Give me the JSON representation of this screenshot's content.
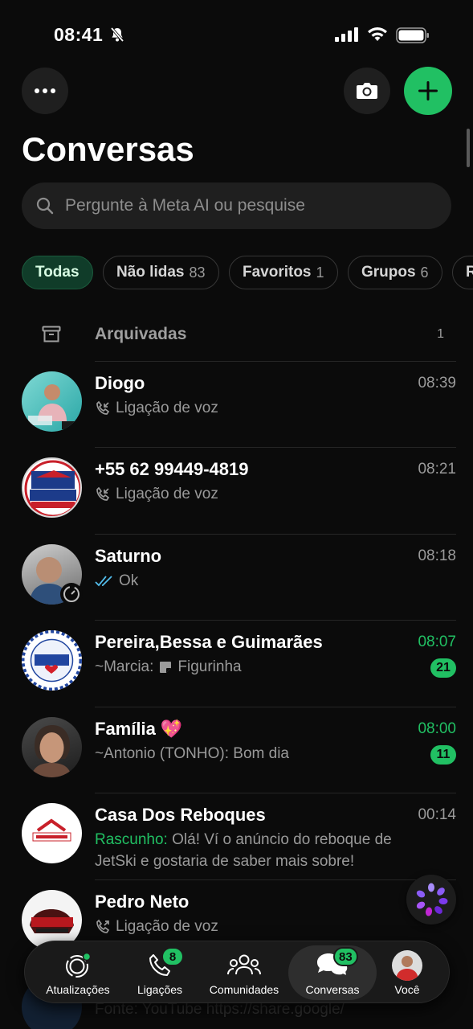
{
  "status_bar": {
    "time": "08:41"
  },
  "header": {
    "title": "Conversas"
  },
  "search": {
    "placeholder": "Pergunte à Meta AI ou pesquise"
  },
  "filters": [
    {
      "label": "Todas",
      "count": "",
      "active": true
    },
    {
      "label": "Não lidas",
      "count": "83"
    },
    {
      "label": "Favoritos",
      "count": "1"
    },
    {
      "label": "Grupos",
      "count": "6"
    },
    {
      "label": "R",
      "count": ""
    }
  ],
  "archived": {
    "label": "Arquivadas",
    "count": "1"
  },
  "chats": [
    {
      "name": "Diogo",
      "time": "08:39",
      "preview": "Ligação de voz",
      "icon": "call-incoming-icon"
    },
    {
      "name": "+55 62 99449-4819",
      "time": "08:21",
      "preview": "Ligação de voz",
      "icon": "call-incoming-icon"
    },
    {
      "name": "Saturno",
      "time": "08:18",
      "preview": "Ok",
      "icon": "double-check-icon"
    },
    {
      "name": "Pereira,Bessa e Guimarães",
      "time": "08:07",
      "sender": "~Marcia:",
      "preview": "Figurinha",
      "icon": "sticker-icon",
      "badge": "21"
    },
    {
      "name": "Família 💖",
      "time": "08:00",
      "preview": "~Antonio (TONHO): Bom dia",
      "badge": "11"
    },
    {
      "name": "Casa Dos Reboques",
      "time": "00:14",
      "draft_label": "Rascunho:",
      "preview": "Olá! Ví o anúncio do reboque de JetSki e gostaria de saber mais sobre!"
    },
    {
      "name": "Pedro Neto",
      "time": "",
      "preview": "Ligação de voz",
      "icon": "call-outgoing-icon"
    }
  ],
  "ghost_row": {
    "preview": "Fonte: YouTube https://share.google/"
  },
  "tabbar": [
    {
      "label": "Atualizações",
      "icon": "status-icon"
    },
    {
      "label": "Ligações",
      "icon": "phone-icon",
      "badge": "8"
    },
    {
      "label": "Comunidades",
      "icon": "communities-icon"
    },
    {
      "label": "Conversas",
      "icon": "chats-icon",
      "badge": "83",
      "active": true
    },
    {
      "label": "Você",
      "icon": "profile-avatar"
    }
  ],
  "colors": {
    "accent": "#21c063",
    "background": "#0b0b0b",
    "surface": "#1f1f1f"
  }
}
